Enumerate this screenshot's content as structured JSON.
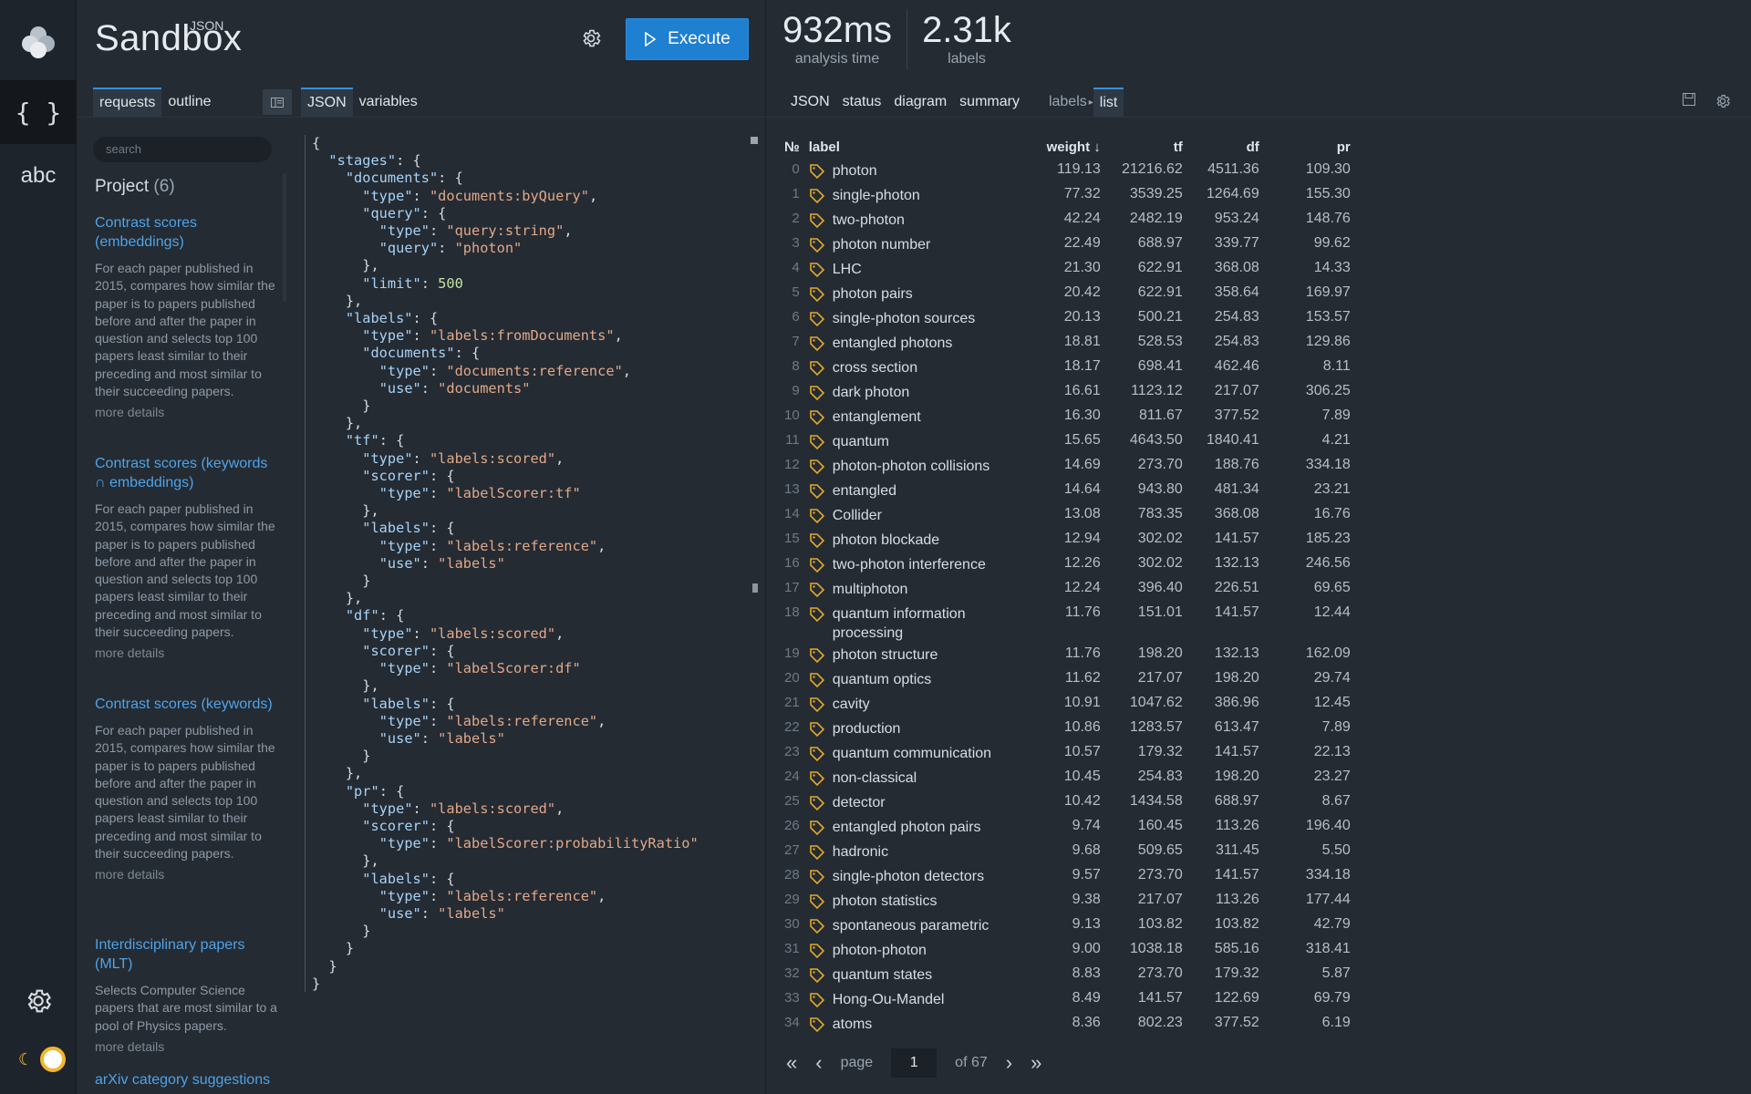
{
  "brand": {
    "small": "JSON",
    "big": "Sandbox"
  },
  "toolbar": {
    "execute_label": "Execute"
  },
  "metrics": [
    {
      "value": "932ms",
      "label": "analysis time"
    },
    {
      "value": "2.31k",
      "label": "labels"
    }
  ],
  "left_tabs": [
    "requests",
    "outline"
  ],
  "mid_tabs": [
    "JSON",
    "variables"
  ],
  "right_tabs": [
    "JSON",
    "status",
    "diagram",
    "summary",
    "labels",
    "list"
  ],
  "sidebar": {
    "search_placeholder": "search",
    "project_label": "Project",
    "project_count": "(6)",
    "entries": [
      {
        "title": "Contrast scores (embeddings)",
        "desc": "For each paper published in 2015, compares how similar the paper is to papers published before and after the paper in question and selects top 100 papers least similar to their preceding and most similar to their succeeding papers.",
        "more": "more details"
      },
      {
        "title": "Contrast scores (keywords ∩ embeddings)",
        "desc": "For each paper published in 2015, compares how similar the paper is to papers published before and after the paper in question and selects top 100 papers least similar to their preceding and most similar to their succeeding papers.",
        "more": "more details"
      },
      {
        "title": "Contrast scores (keywords)",
        "desc": "For each paper published in 2015, compares how similar the paper is to papers published before and after the paper in question and selects top 100 papers least similar to their preceding and most similar to their succeeding papers.",
        "more": "more details"
      },
      {
        "title": "Interdisciplinary papers (MLT)",
        "desc": "Selects Computer Science papers that are most similar to a pool of Physics papers.",
        "more": "more details"
      },
      {
        "title": "arXiv category suggestions",
        "desc": "",
        "more": ""
      }
    ]
  },
  "editor": {
    "lines": [
      [
        "{"
      ],
      [
        "  ",
        "k:\"stages\"",
        ": {"
      ],
      [
        "    ",
        "k:\"documents\"",
        ": {"
      ],
      [
        "      ",
        "k:\"type\"",
        ": ",
        "s:\"documents:byQuery\"",
        ","
      ],
      [
        "      ",
        "k:\"query\"",
        ": {"
      ],
      [
        "        ",
        "k:\"type\"",
        ": ",
        "s:\"query:string\"",
        ","
      ],
      [
        "        ",
        "k:\"query\"",
        ": ",
        "s:\"photon\""
      ],
      [
        "      },"
      ],
      [
        "      ",
        "k:\"limit\"",
        ": ",
        "n:500"
      ],
      [
        "    },"
      ],
      [
        "    ",
        "k:\"labels\"",
        ": {"
      ],
      [
        "      ",
        "k:\"type\"",
        ": ",
        "s:\"labels:fromDocuments\"",
        ","
      ],
      [
        "      ",
        "k:\"documents\"",
        ": {"
      ],
      [
        "        ",
        "k:\"type\"",
        ": ",
        "s:\"documents:reference\"",
        ","
      ],
      [
        "        ",
        "k:\"use\"",
        ": ",
        "s:\"documents\""
      ],
      [
        "      }"
      ],
      [
        "    },"
      ],
      [
        "    ",
        "k:\"tf\"",
        ": {"
      ],
      [
        "      ",
        "k:\"type\"",
        ": ",
        "s:\"labels:scored\"",
        ","
      ],
      [
        "      ",
        "k:\"scorer\"",
        ": {"
      ],
      [
        "        ",
        "k:\"type\"",
        ": ",
        "s:\"labelScorer:tf\""
      ],
      [
        "      },"
      ],
      [
        "      ",
        "k:\"labels\"",
        ": {"
      ],
      [
        "        ",
        "k:\"type\"",
        ": ",
        "s:\"labels:reference\"",
        ","
      ],
      [
        "        ",
        "k:\"use\"",
        ": ",
        "s:\"labels\""
      ],
      [
        "      }"
      ],
      [
        "    },"
      ],
      [
        "    ",
        "k:\"df\"",
        ": {"
      ],
      [
        "      ",
        "k:\"type\"",
        ": ",
        "s:\"labels:scored\"",
        ","
      ],
      [
        "      ",
        "k:\"scorer\"",
        ": {"
      ],
      [
        "        ",
        "k:\"type\"",
        ": ",
        "s:\"labelScorer:df\""
      ],
      [
        "      },"
      ],
      [
        "      ",
        "k:\"labels\"",
        ": {"
      ],
      [
        "        ",
        "k:\"type\"",
        ": ",
        "s:\"labels:reference\"",
        ","
      ],
      [
        "        ",
        "k:\"use\"",
        ": ",
        "s:\"labels\""
      ],
      [
        "      }"
      ],
      [
        "    },"
      ],
      [
        "    ",
        "k:\"pr\"",
        ": {"
      ],
      [
        "      ",
        "k:\"type\"",
        ": ",
        "s:\"labels:scored\"",
        ","
      ],
      [
        "      ",
        "k:\"scorer\"",
        ": {"
      ],
      [
        "        ",
        "k:\"type\"",
        ": ",
        "s:\"labelScorer:probabilityRatio\""
      ],
      [
        "      },"
      ],
      [
        "      ",
        "k:\"labels\"",
        ": {"
      ],
      [
        "        ",
        "k:\"type\"",
        ": ",
        "s:\"labels:reference\"",
        ","
      ],
      [
        "        ",
        "k:\"use\"",
        ": ",
        "s:\"labels\""
      ],
      [
        "      }"
      ],
      [
        "    }"
      ],
      [
        "  }"
      ],
      [
        "}"
      ]
    ]
  },
  "table": {
    "headers": {
      "idx": "№",
      "label": "label",
      "weight": "weight ↓",
      "tf": "tf",
      "df": "df",
      "pr": "pr"
    },
    "rows": [
      [
        "0",
        "photon",
        "119.13",
        "21216.62",
        "4511.36",
        "109.30"
      ],
      [
        "1",
        "single-photon",
        "77.32",
        "3539.25",
        "1264.69",
        "155.30"
      ],
      [
        "2",
        "two-photon",
        "42.24",
        "2482.19",
        "953.24",
        "148.76"
      ],
      [
        "3",
        "photon number",
        "22.49",
        "688.97",
        "339.77",
        "99.62"
      ],
      [
        "4",
        "LHC",
        "21.30",
        "622.91",
        "368.08",
        "14.33"
      ],
      [
        "5",
        "photon pairs",
        "20.42",
        "622.91",
        "358.64",
        "169.97"
      ],
      [
        "6",
        "single-photon sources",
        "20.13",
        "500.21",
        "254.83",
        "153.57"
      ],
      [
        "7",
        "entangled photons",
        "18.81",
        "528.53",
        "254.83",
        "129.86"
      ],
      [
        "8",
        "cross section",
        "18.17",
        "698.41",
        "462.46",
        "8.11"
      ],
      [
        "9",
        "dark photon",
        "16.61",
        "1123.12",
        "217.07",
        "306.25"
      ],
      [
        "10",
        "entanglement",
        "16.30",
        "811.67",
        "377.52",
        "7.89"
      ],
      [
        "11",
        "quantum",
        "15.65",
        "4643.50",
        "1840.41",
        "4.21"
      ],
      [
        "12",
        "photon-photon collisions",
        "14.69",
        "273.70",
        "188.76",
        "334.18"
      ],
      [
        "13",
        "entangled",
        "14.64",
        "943.80",
        "481.34",
        "23.21"
      ],
      [
        "14",
        "Collider",
        "13.08",
        "783.35",
        "368.08",
        "16.76"
      ],
      [
        "15",
        "photon blockade",
        "12.94",
        "302.02",
        "141.57",
        "185.23"
      ],
      [
        "16",
        "two-photon interference",
        "12.26",
        "302.02",
        "132.13",
        "246.56"
      ],
      [
        "17",
        "multiphoton",
        "12.24",
        "396.40",
        "226.51",
        "69.65"
      ],
      [
        "18",
        "quantum information processing",
        "11.76",
        "151.01",
        "141.57",
        "12.44"
      ],
      [
        "19",
        "photon structure",
        "11.76",
        "198.20",
        "132.13",
        "162.09"
      ],
      [
        "20",
        "quantum optics",
        "11.62",
        "217.07",
        "198.20",
        "29.74"
      ],
      [
        "21",
        "cavity",
        "10.91",
        "1047.62",
        "386.96",
        "12.45"
      ],
      [
        "22",
        "production",
        "10.86",
        "1283.57",
        "613.47",
        "7.89"
      ],
      [
        "23",
        "quantum communication",
        "10.57",
        "179.32",
        "141.57",
        "22.13"
      ],
      [
        "24",
        "non-classical",
        "10.45",
        "254.83",
        "198.20",
        "23.27"
      ],
      [
        "25",
        "detector",
        "10.42",
        "1434.58",
        "688.97",
        "8.67"
      ],
      [
        "26",
        "entangled photon pairs",
        "9.74",
        "160.45",
        "113.26",
        "196.40"
      ],
      [
        "27",
        "hadronic",
        "9.68",
        "509.65",
        "311.45",
        "5.50"
      ],
      [
        "28",
        "single-photon detectors",
        "9.57",
        "273.70",
        "141.57",
        "334.18"
      ],
      [
        "29",
        "photon statistics",
        "9.38",
        "217.07",
        "113.26",
        "177.44"
      ],
      [
        "30",
        "spontaneous parametric",
        "9.13",
        "103.82",
        "103.82",
        "42.79"
      ],
      [
        "31",
        "photon-photon",
        "9.00",
        "1038.18",
        "585.16",
        "318.41"
      ],
      [
        "32",
        "quantum states",
        "8.83",
        "273.70",
        "179.32",
        "5.87"
      ],
      [
        "33",
        "Hong-Ou-Mandel",
        "8.49",
        "141.57",
        "122.69",
        "69.79"
      ],
      [
        "34",
        "atoms",
        "8.36",
        "802.23",
        "377.52",
        "6.19"
      ]
    ]
  },
  "pager": {
    "page_label": "page",
    "current": "1",
    "of_label": "of",
    "total": "67"
  },
  "colors": {
    "accent": "#1f7fd0",
    "link": "#4ea3e8",
    "tag": "#e3a92b"
  }
}
